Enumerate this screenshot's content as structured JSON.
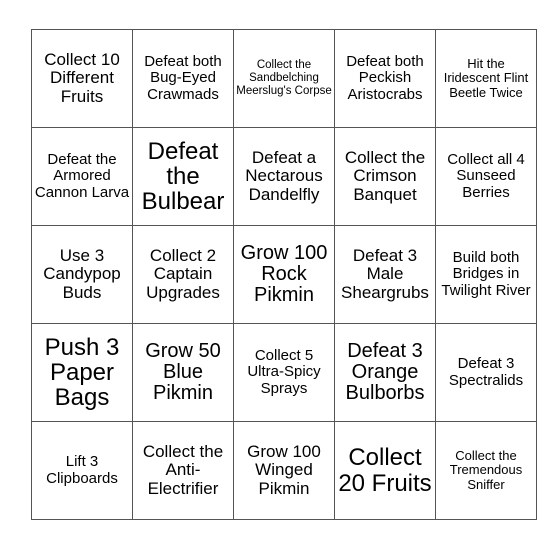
{
  "card": {
    "type": "bingo-card",
    "rows": 5,
    "columns": 5,
    "border_color": "#555555",
    "text_color": "#000000",
    "background_color": "#ffffff",
    "cells": [
      [
        {
          "text": "Collect 10 Different Fruits",
          "size": "l"
        },
        {
          "text": "Defeat both Bug-Eyed Crawmads",
          "size": "m"
        },
        {
          "text": "Collect the Sandbelching Meerslug's Corpse",
          "size": "xs"
        },
        {
          "text": "Defeat both Peckish Aristocrabs",
          "size": "m"
        },
        {
          "text": "Hit the Iridescent Flint Beetle Twice",
          "size": "s"
        }
      ],
      [
        {
          "text": "Defeat the Armored Cannon Larva",
          "size": "m"
        },
        {
          "text": "Defeat the Bulbear",
          "size": "xxl"
        },
        {
          "text": "Defeat a Nectarous Dandelfly",
          "size": "l"
        },
        {
          "text": "Collect the Crimson Banquet",
          "size": "l"
        },
        {
          "text": "Collect all 4 Sunseed Berries",
          "size": "m"
        }
      ],
      [
        {
          "text": "Use 3 Candypop Buds",
          "size": "l"
        },
        {
          "text": "Collect 2 Captain Upgrades",
          "size": "l"
        },
        {
          "text": "Grow 100 Rock Pikmin",
          "size": "xl"
        },
        {
          "text": "Defeat 3 Male Sheargrubs",
          "size": "l"
        },
        {
          "text": "Build both Bridges in Twilight River",
          "size": "m"
        }
      ],
      [
        {
          "text": "Push 3 Paper Bags",
          "size": "xxl"
        },
        {
          "text": "Grow 50 Blue Pikmin",
          "size": "xl"
        },
        {
          "text": "Collect 5 Ultra-Spicy Sprays",
          "size": "m"
        },
        {
          "text": "Defeat 3 Orange Bulborbs",
          "size": "xl"
        },
        {
          "text": "Defeat 3 Spectralids",
          "size": "m"
        }
      ],
      [
        {
          "text": "Lift 3 Clipboards",
          "size": "m"
        },
        {
          "text": "Collect the Anti-Electrifier",
          "size": "l"
        },
        {
          "text": "Grow 100 Winged Pikmin",
          "size": "l"
        },
        {
          "text": "Collect 20 Fruits",
          "size": "xxl"
        },
        {
          "text": "Collect the Tremendous Sniffer",
          "size": "s"
        }
      ]
    ]
  }
}
